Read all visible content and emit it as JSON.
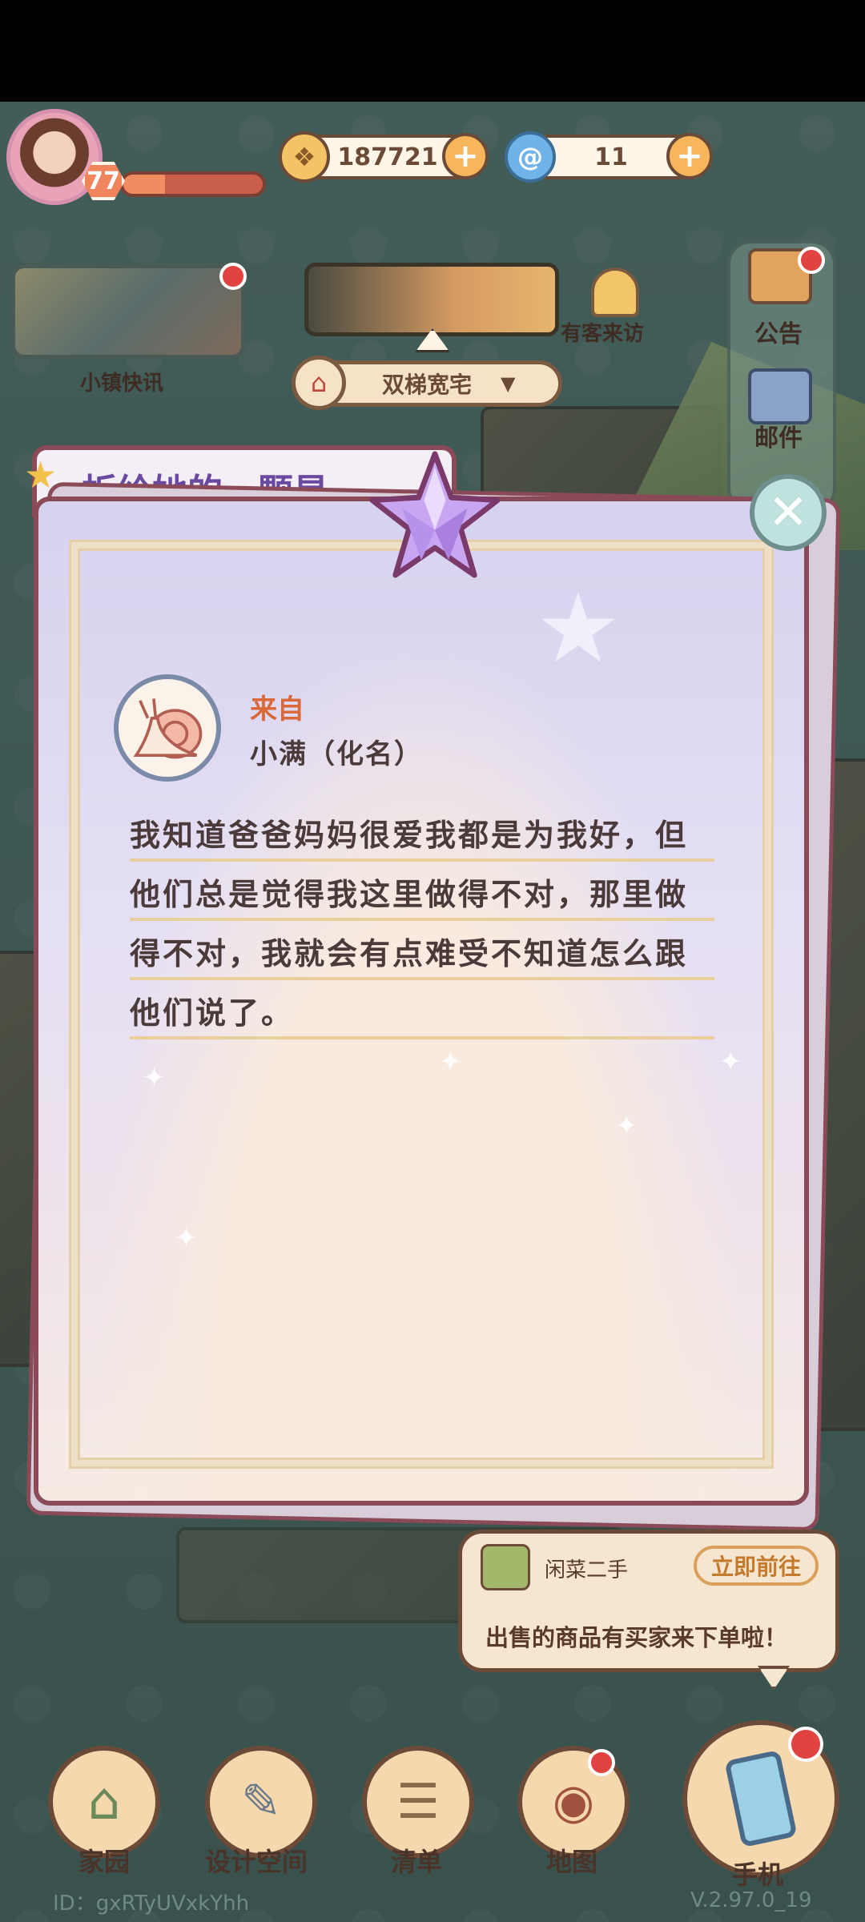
{
  "hud": {
    "level": "77",
    "level_progress": 0.3,
    "coins": "187721",
    "gems": "11",
    "news_label": "小镇快讯",
    "house_label": "双梯宽宅",
    "visitor_label": "有客来访",
    "rail": [
      {
        "label": "公告",
        "icon": "announcement-icon"
      },
      {
        "label": "邮件",
        "icon": "mail-icon"
      }
    ]
  },
  "dialog": {
    "title": "折给她的一颗星",
    "from_label": "来自",
    "sender": "小满（化名）",
    "message": "我知道爸爸妈妈很爱我都是为我好，但他们总是觉得我这里做得不对，那里做得不对，我就会有点难受不知道怎么跟他们说了。"
  },
  "notification": {
    "app": "闲菜二手",
    "action": "立即前往",
    "message": "出售的商品有买家来下单啦！"
  },
  "nav": [
    {
      "label": "家园"
    },
    {
      "label": "设计空间"
    },
    {
      "label": "清单"
    },
    {
      "label": "地图"
    },
    {
      "label": "手机"
    }
  ],
  "footer": {
    "player_id": "ID：gxRTyUVxkYhh",
    "version": "V.2.97.0_19"
  },
  "colors": {
    "accent": "#f08c5f",
    "dialog_border": "#8a4a58",
    "notice_red": "#e14440"
  }
}
